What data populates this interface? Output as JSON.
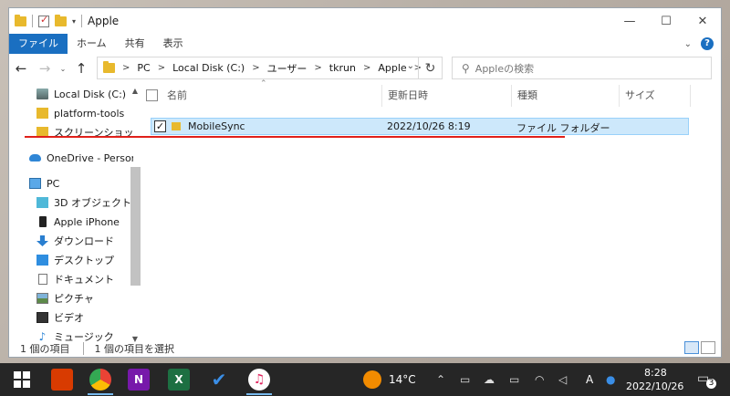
{
  "window": {
    "title": "Apple",
    "controls": [
      "—",
      "☐",
      "✕"
    ]
  },
  "ribbon": {
    "tabs": [
      "ファイル",
      "ホーム",
      "共有",
      "表示"
    ]
  },
  "address": {
    "crumbs": [
      "PC",
      "Local Disk (C:)",
      "ユーザー",
      "tkrun",
      "Apple"
    ],
    "search_placeholder": "Appleの検索"
  },
  "nav": {
    "items": [
      {
        "label": "Local Disk (C:)",
        "icon": "drive-icon"
      },
      {
        "label": "platform-tools",
        "icon": "folder-icon"
      },
      {
        "label": "スクリーンショット",
        "icon": "folder-icon"
      },
      {
        "label": "OneDrive - Person",
        "icon": "onedrive-icon"
      },
      {
        "label": "PC",
        "icon": "pc-icon"
      },
      {
        "label": "3D オブジェクト",
        "icon": "3d-objects-icon"
      },
      {
        "label": "Apple iPhone",
        "icon": "iphone-icon"
      },
      {
        "label": "ダウンロード",
        "icon": "download-icon"
      },
      {
        "label": "デスクトップ",
        "icon": "desktop-icon"
      },
      {
        "label": "ドキュメント",
        "icon": "document-icon"
      },
      {
        "label": "ピクチャ",
        "icon": "pictures-icon"
      },
      {
        "label": "ビデオ",
        "icon": "video-icon"
      },
      {
        "label": "ミュージック",
        "icon": "music-icon"
      }
    ]
  },
  "columns": {
    "name": "名前",
    "modified": "更新日時",
    "type": "種類",
    "size": "サイズ"
  },
  "files": [
    {
      "name": "MobileSync",
      "modified": "2022/10/26 8:19",
      "type": "ファイル フォルダー",
      "size": "",
      "selected": true
    }
  ],
  "status": {
    "count": "1 個の項目",
    "selected": "1 個の項目を選択"
  },
  "taskbar": {
    "apps": [
      "office-icon",
      "chrome-icon",
      "onenote-icon",
      "excel-icon",
      "todo-icon",
      "itunes-icon"
    ],
    "weather": "14°C",
    "ime": "A",
    "time": "8:28",
    "date": "2022/10/26",
    "notifications": "3"
  }
}
